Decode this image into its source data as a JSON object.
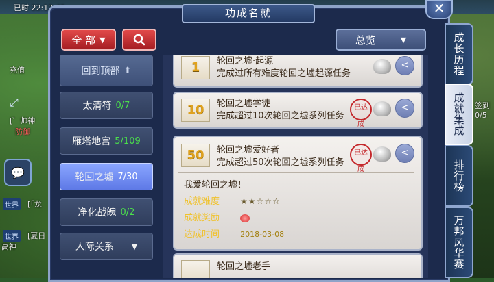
{
  "background": {
    "time": "已时 22:12:43",
    "recharge": "充值",
    "player_line": "[゛帅神",
    "defense": "防御",
    "world_chip_1": "世界",
    "world_text_1": "[「龙",
    "world_chip_2": "世界",
    "world_text_2": "[夏日",
    "high_god": "高神",
    "right_text_1": "签到",
    "right_text_2": "0/5"
  },
  "dialog": {
    "title": "功成名就",
    "filter_label": "全 部",
    "search_icon": "search-icon",
    "overview_label": "总览"
  },
  "categories": {
    "top_label": "回到顶部",
    "items": [
      {
        "name": "太清符",
        "count": "0/7"
      },
      {
        "name": "雁塔地宫",
        "count": "5/109"
      },
      {
        "name": "轮回之墟",
        "count": "7/30"
      },
      {
        "name": "净化战魄",
        "count": "0/2"
      }
    ],
    "more_label": "人际关系"
  },
  "achievements": [
    {
      "level": "1",
      "name": "轮回之墟·起源",
      "desc": "完成过所有难度轮回之墟起源任务"
    },
    {
      "level": "10",
      "name": "轮回之墟学徒",
      "desc": "完成超过10次轮回之墟系列任务",
      "seal": "已达成"
    },
    {
      "level": "50",
      "name": "轮回之墟爱好者",
      "desc": "完成超过50次轮回之墟系列任务",
      "seal": "已达成",
      "detail": {
        "title": "我爱轮回之墟！",
        "difficulty_label": "成就难度",
        "difficulty_value": "★★☆☆☆",
        "reward_label": "成就奖励",
        "date_label": "达成时间",
        "date_value": "2018-03-08"
      }
    },
    {
      "level": "",
      "name": "轮回之墟老手",
      "desc": ""
    }
  ],
  "side_tabs": [
    "成长历程",
    "成就集成",
    "排行榜",
    "万邦风华赛"
  ],
  "colors": {
    "accent_red": "#c4282c",
    "active_blue": "#6f8af0",
    "count_green": "#4be04b",
    "label_gold": "#f0c22d"
  }
}
